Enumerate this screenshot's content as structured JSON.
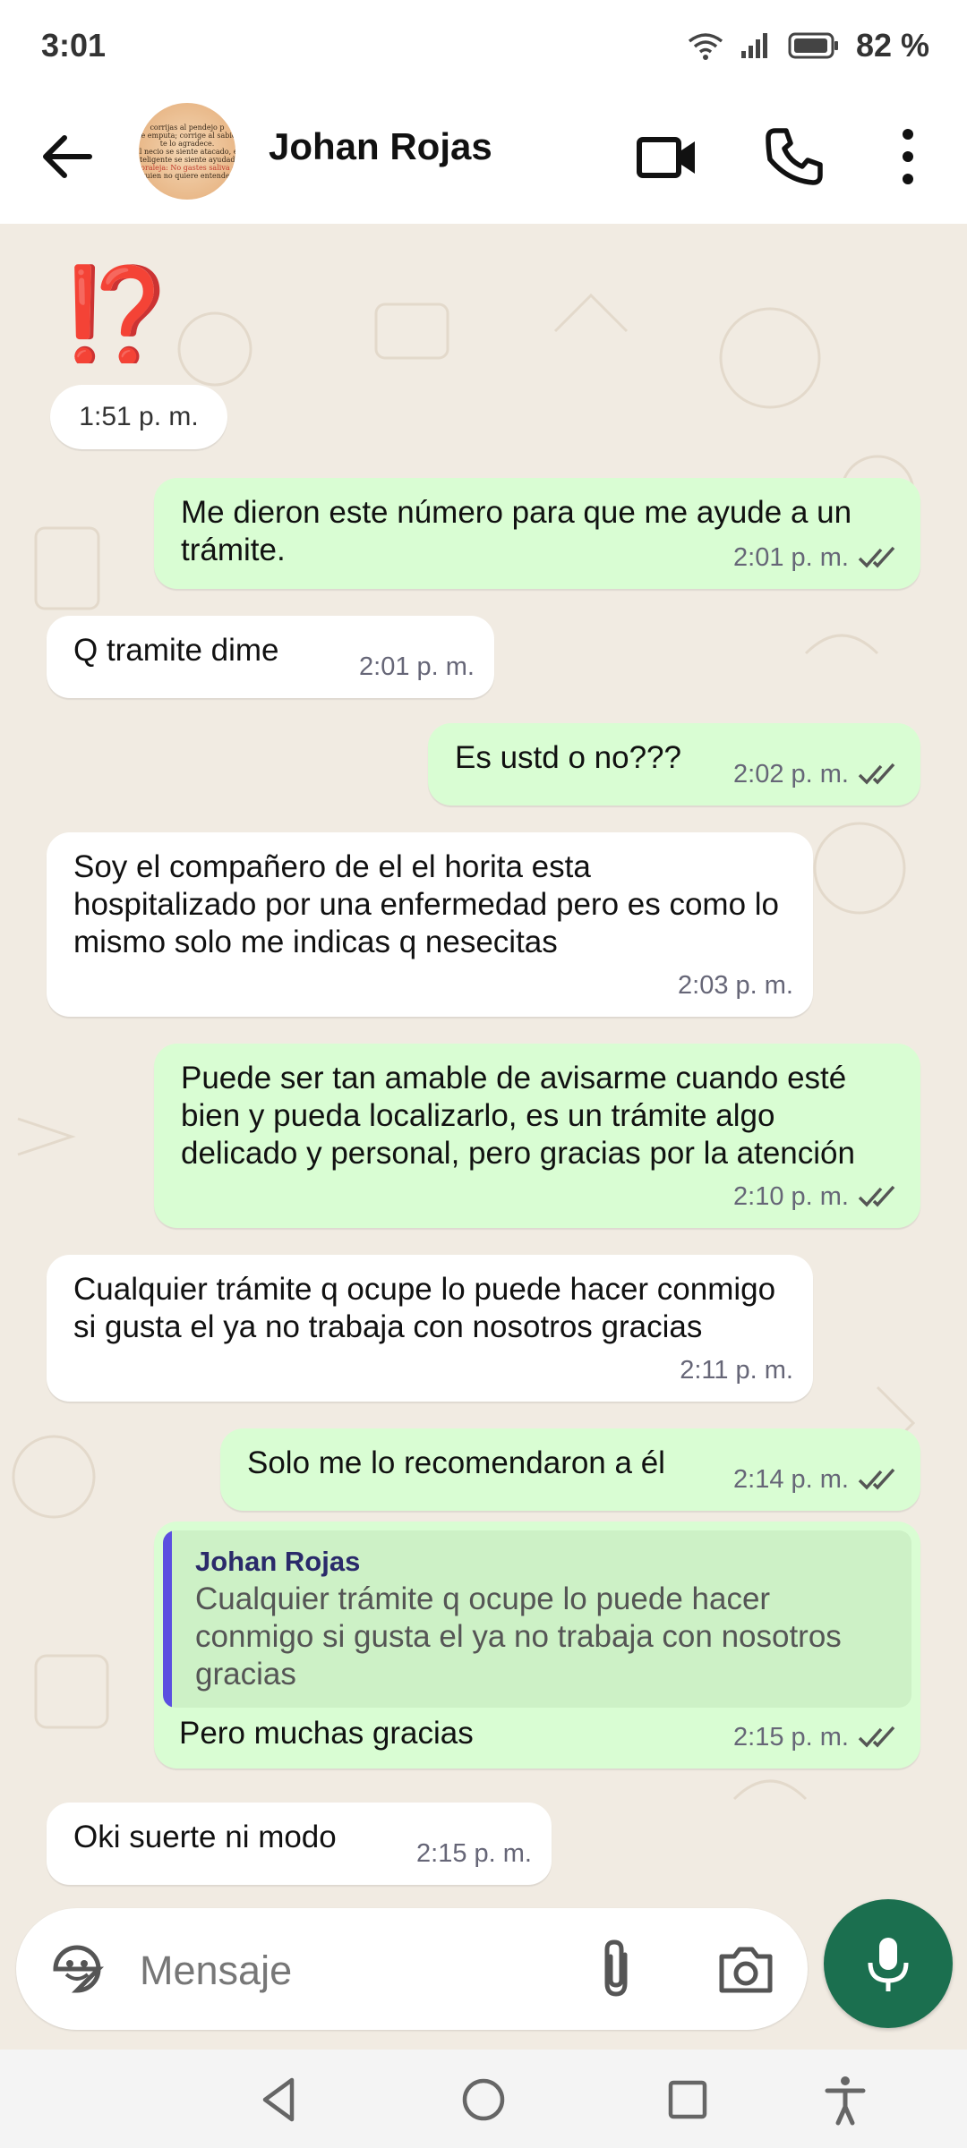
{
  "status_bar": {
    "time": "3:01",
    "battery": "82 %"
  },
  "header": {
    "contact_name": "Johan Rojas",
    "avatar_lines": [
      "corrijas al pendejo p",
      "te emputa; corrige al sabio",
      "te lo agradece.",
      "El necio se siente atacado, el",
      "inteligente se siente ayudado.",
      "Moraleja: No gastes saliva en",
      "quien no quiere entender"
    ]
  },
  "chat": {
    "sticker": "⁉️",
    "date_pill": "1:51 p. m.",
    "messages": [
      {
        "dir": "out",
        "text": "Me dieron este número para que me ayude a un trámite.",
        "time": "2:01 p. m."
      },
      {
        "dir": "in",
        "text": "Q tramite dime",
        "time": "2:01 p. m."
      },
      {
        "dir": "out",
        "text": "Es ustd o no???",
        "time": "2:02 p. m."
      },
      {
        "dir": "in",
        "text": "Soy el compañero de el el horita esta hospitalizado por una enfermedad pero es como lo mismo solo me indicas q nesecitas",
        "time": "2:03 p. m."
      },
      {
        "dir": "out",
        "text": "Puede ser tan amable de avisarme cuando esté bien y pueda localizarlo, es un trámite algo delicado y personal, pero gracias por la atención",
        "time": "2:10 p. m."
      },
      {
        "dir": "in",
        "text": "Cualquier trámite q ocupe lo puede hacer conmigo si gusta el ya no trabaja con nosotros gracias",
        "time": "2:11 p. m."
      },
      {
        "dir": "out",
        "text": "Solo me lo recomendaron a él",
        "time": "2:14 p. m."
      },
      {
        "dir": "out",
        "text": "Pero muchas gracias",
        "time": "2:15 p. m.",
        "quote_name": "Johan Rojas",
        "quote_text": "Cualquier trámite q ocupe lo puede hacer conmigo si gusta el ya no trabaja con nosotros gracias"
      },
      {
        "dir": "in",
        "text": "Oki suerte ni modo",
        "time": "2:15 p. m."
      }
    ]
  },
  "composer": {
    "placeholder": "Mensaje"
  },
  "colors": {
    "outgoing": "#d9fdd3",
    "incoming": "#ffffff",
    "chat_bg": "#f1ebe2",
    "mic": "#1b6f4f",
    "tick": "#5b5b5b"
  }
}
